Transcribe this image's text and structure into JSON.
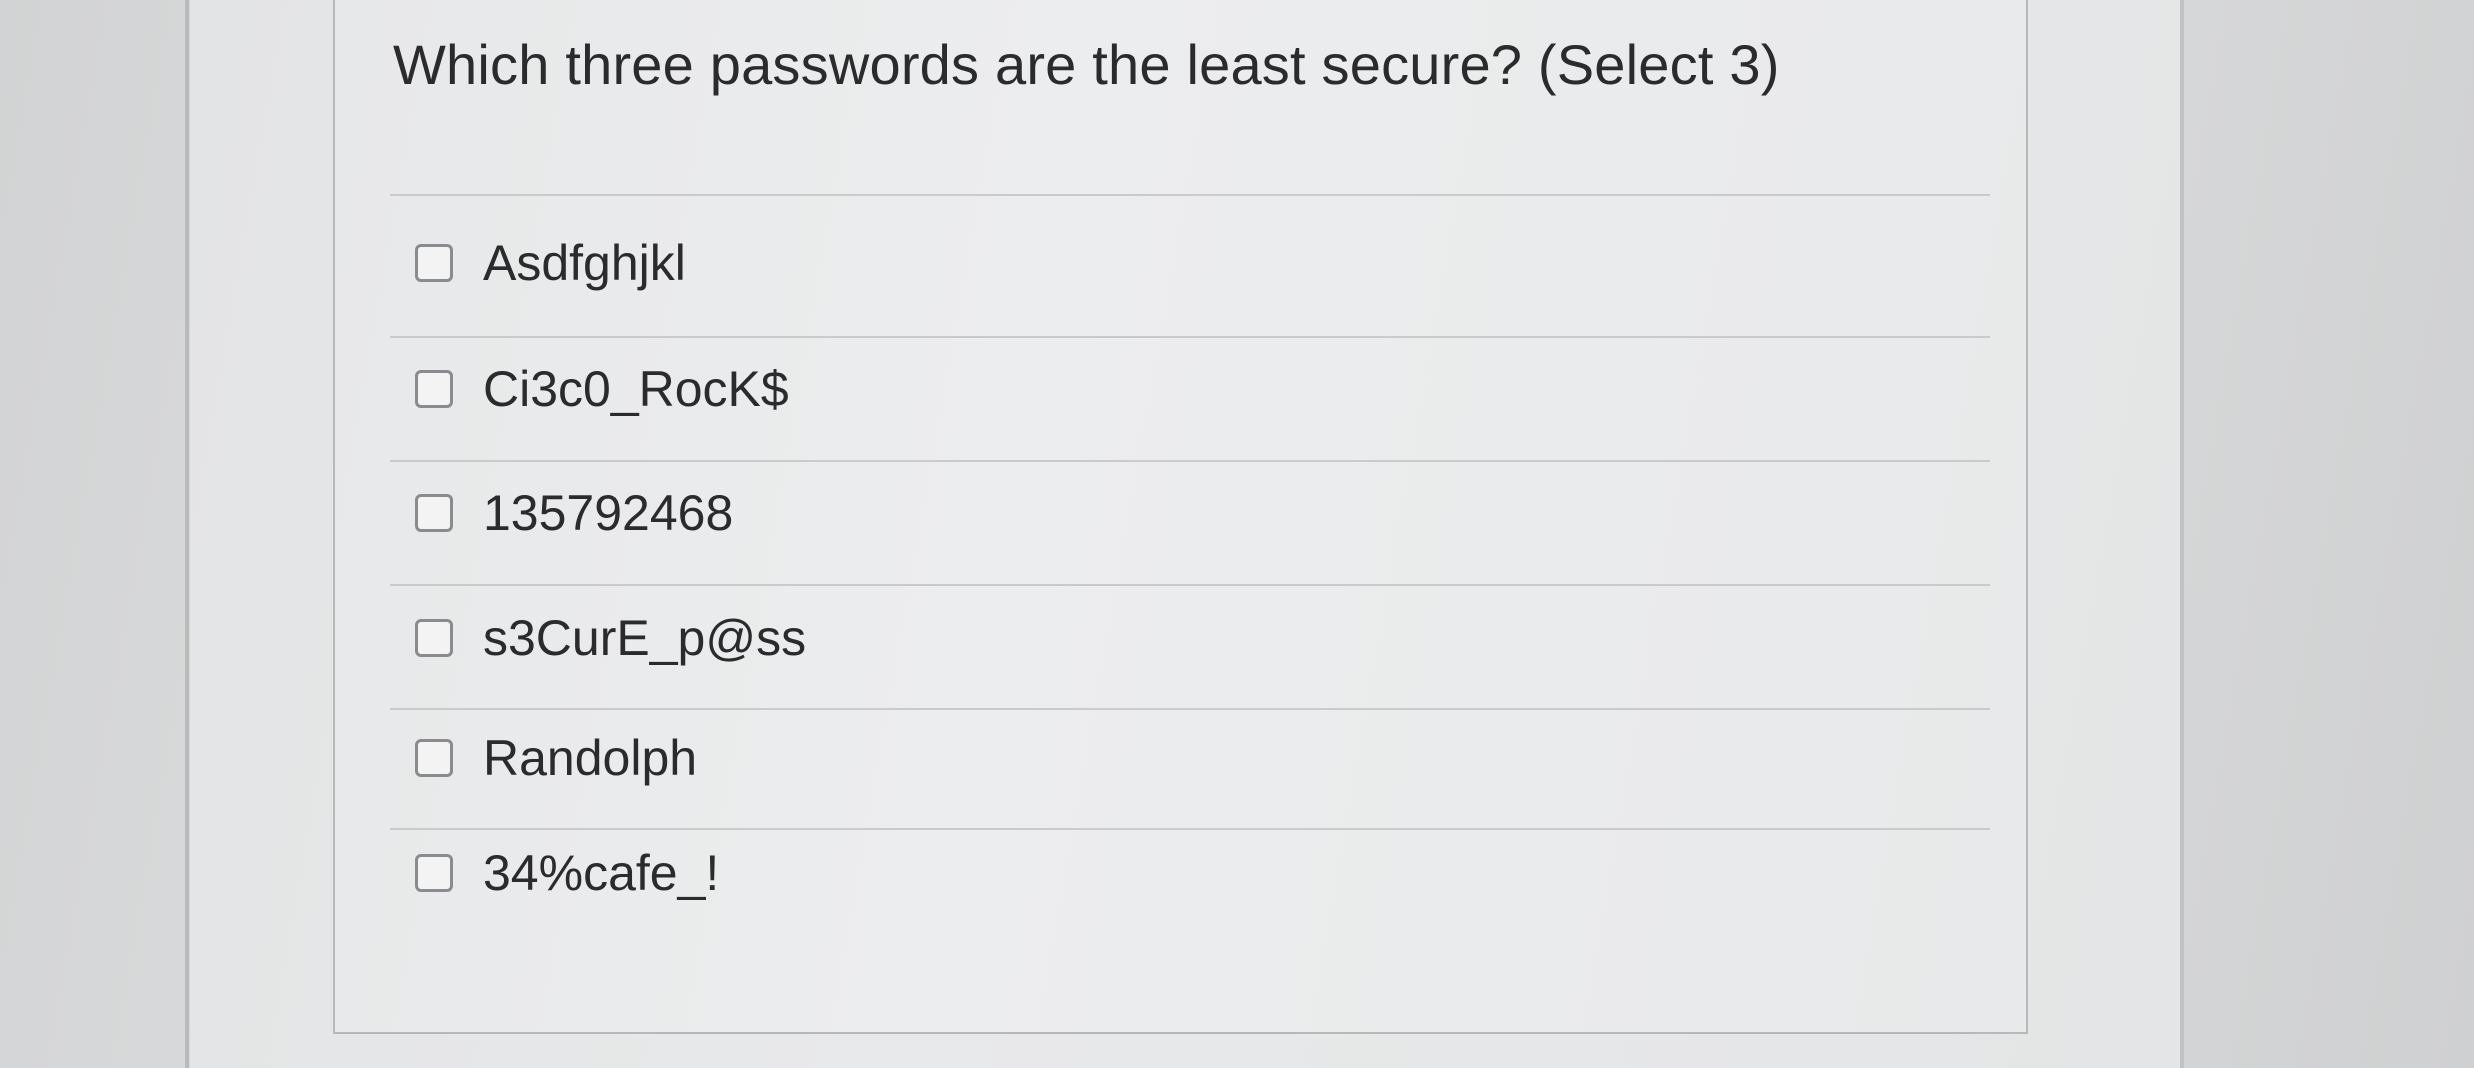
{
  "question": {
    "text": "Which three passwords are the least secure? (Select 3)"
  },
  "options": [
    {
      "label": "Asdfghjkl",
      "checked": false
    },
    {
      "label": "Ci3c0_RocK$",
      "checked": false
    },
    {
      "label": "135792468",
      "checked": false
    },
    {
      "label": "s3CurE_p@ss",
      "checked": false
    },
    {
      "label": "Randolph",
      "checked": false
    },
    {
      "label": "34%cafe_!",
      "checked": false
    }
  ]
}
